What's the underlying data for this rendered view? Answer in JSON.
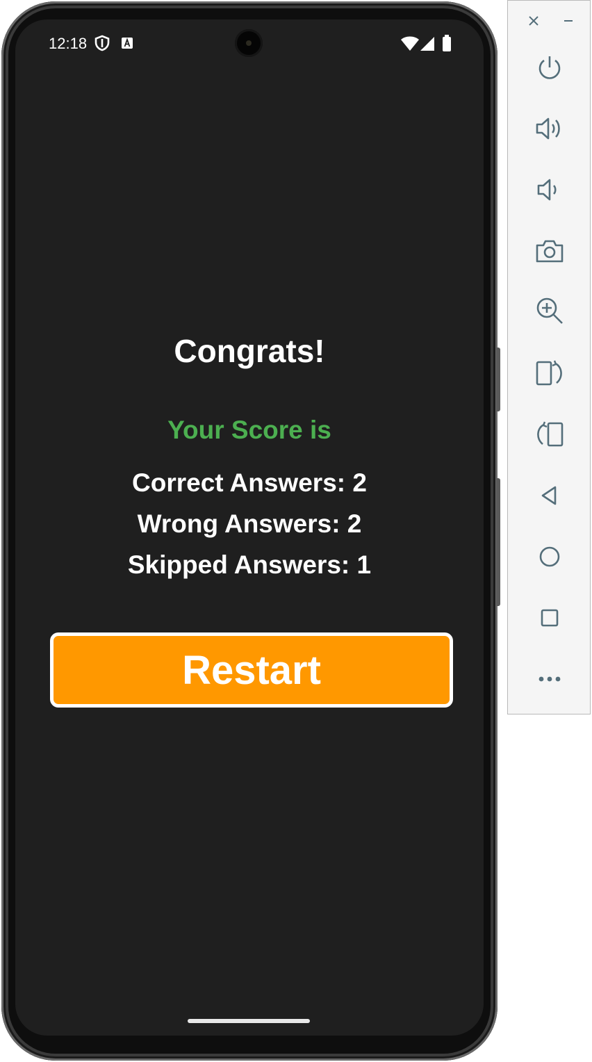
{
  "status_bar": {
    "time": "12:18"
  },
  "screen": {
    "title": "Congrats!",
    "score_label": "Your Score is",
    "correct": "Correct Answers: 2",
    "wrong": "Wrong Answers: 2",
    "skipped": "Skipped Answers: 1",
    "restart_label": "Restart"
  },
  "colors": {
    "background": "#1f1f1f",
    "score_green": "#4caf50",
    "restart_orange": "#ff9800",
    "toolbar_icon": "#546e7a"
  },
  "toolbar": {
    "icons": [
      "close-icon",
      "minimize-icon",
      "power-icon",
      "volume-up-icon",
      "volume-down-icon",
      "camera-icon",
      "zoom-icon",
      "rotate-left-icon",
      "rotate-right-icon",
      "back-icon",
      "home-icon",
      "overview-icon",
      "more-icon"
    ]
  }
}
